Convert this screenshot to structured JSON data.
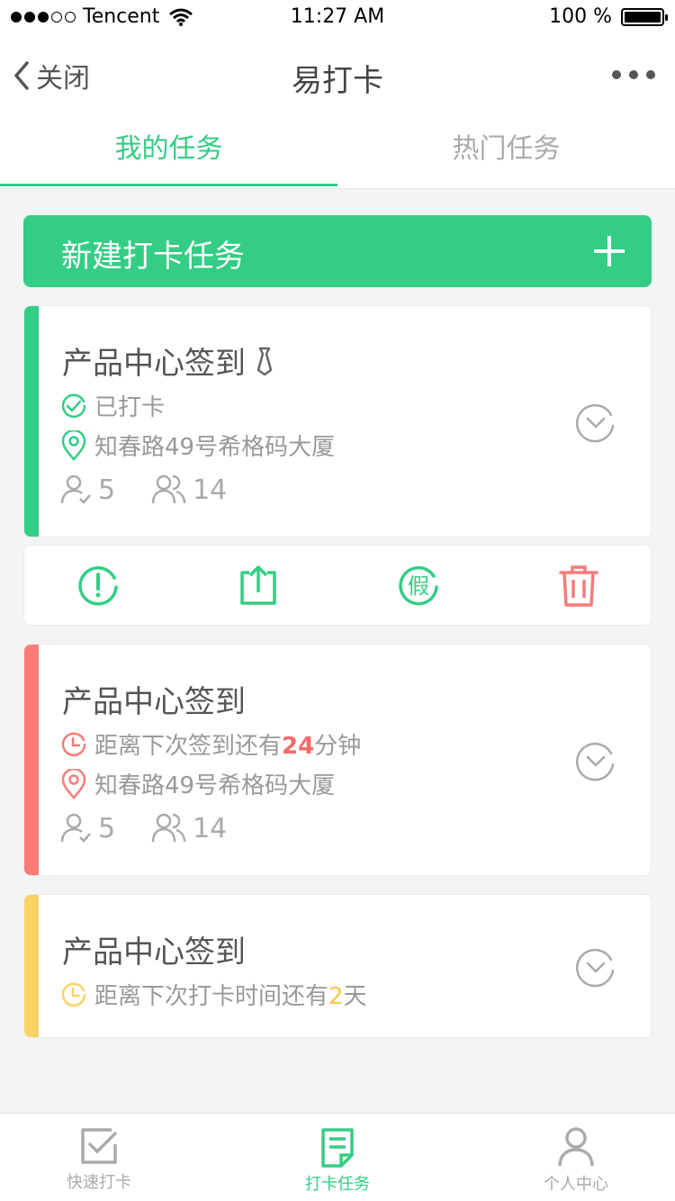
{
  "status_bar": {
    "carrier": "Tencent",
    "time": "11:27 AM",
    "battery_text": "100 %"
  },
  "nav": {
    "back_label": "关闭",
    "title": "易打卡"
  },
  "tabs": [
    {
      "label": "我的任务",
      "active": true
    },
    {
      "label": "热门任务",
      "active": false
    }
  ],
  "new_task": {
    "label": "新建打卡任务"
  },
  "tasks": [
    {
      "title": "产品中心签到",
      "status_text": "已打卡",
      "location": "知春路49号希格码大厦",
      "people_single": "5",
      "people_group": "14",
      "accent": "#34cd85"
    },
    {
      "title": "产品中心签到",
      "status_prefix": "距离下次签到还有",
      "status_value": "24",
      "status_suffix": "分钟",
      "location": "知春路49号希格码大厦",
      "people_single": "5",
      "people_group": "14",
      "accent": "#fb7b78"
    },
    {
      "title": "产品中心签到",
      "status_prefix": "距离下次打卡时间还有",
      "status_value": "2",
      "status_suffix": "天",
      "accent": "#fbd266"
    }
  ],
  "actions": [
    "report-icon",
    "share-icon",
    "leave-icon",
    "delete-icon"
  ],
  "action_leave_glyph": "假",
  "tab_bar": [
    {
      "label": "快速打卡",
      "icon": "checkbox-icon",
      "active": false
    },
    {
      "label": "打卡任务",
      "icon": "document-icon",
      "active": true
    },
    {
      "label": "个人中心",
      "icon": "user-icon",
      "active": false
    }
  ],
  "colors": {
    "green": "#34cd85",
    "red": "#fb7b78",
    "yellow": "#fbd266",
    "delete": "#f47c7c"
  }
}
